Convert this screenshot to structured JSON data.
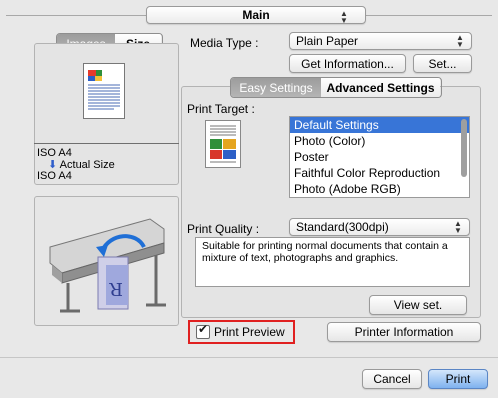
{
  "header": {
    "panel_popup": "Main"
  },
  "left": {
    "tabs": [
      "Images",
      "Size"
    ],
    "paper_size": "ISO A4",
    "actual_size_label": "Actual Size",
    "output_size": "ISO A4"
  },
  "media": {
    "label": "Media Type :",
    "value": "Plain Paper",
    "get_info_button": "Get Information...",
    "set_button": "Set..."
  },
  "settings_tabs": [
    "Easy Settings",
    "Advanced Settings"
  ],
  "print_target": {
    "label": "Print Target :",
    "items": [
      "Default Settings",
      "Photo (Color)",
      "Poster",
      "Faithful Color Reproduction",
      "Photo (Adobe RGB)"
    ],
    "selected_index": 0
  },
  "print_quality": {
    "label": "Print Quality :",
    "value": "Standard(300dpi)",
    "description": "Suitable for printing normal documents that contain a mixture of text, photographs and graphics.",
    "view_button": "View set."
  },
  "print_preview": {
    "label": "Print Preview",
    "checked": true
  },
  "printer_info_button": "Printer Information",
  "footer": {
    "cancel_button": "Cancel",
    "print_button": "Print"
  },
  "colors": {
    "accent": "#3875d7",
    "highlight_box": "#e02020"
  }
}
